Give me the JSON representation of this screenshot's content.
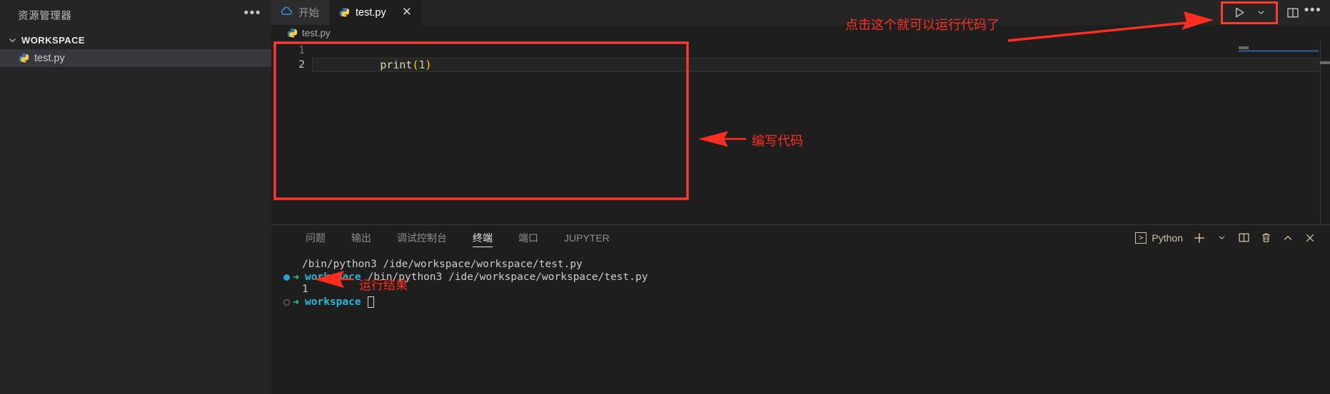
{
  "sidebar": {
    "title": "资源管理器",
    "more_icon": "ellipsis-icon",
    "workspace_label": "WORKSPACE",
    "files": [
      {
        "name": "test.py",
        "icon": "python-file-icon"
      }
    ]
  },
  "tabs": [
    {
      "label": "开始",
      "icon": "cloud-icon",
      "active": false,
      "closable": false
    },
    {
      "label": "test.py",
      "icon": "python-file-icon",
      "active": true,
      "closable": true
    }
  ],
  "tab_actions": {
    "run_icon": "play-triangle-icon",
    "run_dropdown_icon": "chevron-down-icon",
    "split_editor_icon": "split-editor-icon",
    "more_icon": "ellipsis-icon"
  },
  "breadcrumb": {
    "icon": "python-file-icon",
    "label": "test.py"
  },
  "editor": {
    "lines": [
      {
        "number": "1",
        "tokens": [
          {
            "text": "print",
            "type": "fn"
          },
          {
            "text": "(",
            "type": "par"
          },
          {
            "text": "1",
            "type": "num"
          },
          {
            "text": ")",
            "type": "par"
          }
        ],
        "current": false
      },
      {
        "number": "2",
        "tokens": [],
        "current": true
      }
    ]
  },
  "panel": {
    "tabs": [
      {
        "label": "问题",
        "active": false
      },
      {
        "label": "输出",
        "active": false
      },
      {
        "label": "调试控制台",
        "active": false
      },
      {
        "label": "终端",
        "active": true
      },
      {
        "label": "端口",
        "active": false
      },
      {
        "label": "JUPYTER",
        "active": false
      }
    ],
    "actions": {
      "terminal_kind": "Python",
      "terminal_kind_icon": "terminal-chevron-icon",
      "new_terminal_icon": "plus-icon",
      "new_terminal_dropdown_icon": "chevron-down-icon",
      "split_terminal_icon": "split-terminal-icon",
      "kill_terminal_icon": "trash-icon",
      "maximize_panel_icon": "chevron-up-icon",
      "close_panel_icon": "close-icon"
    },
    "terminal_lines": [
      {
        "marker": "none",
        "prompt": false,
        "text": "/bin/python3 /ide/workspace/workspace/test.py"
      },
      {
        "marker": "filled",
        "prompt": true,
        "user": "workspace",
        "text": "/bin/python3 /ide/workspace/workspace/test.py"
      },
      {
        "marker": "none",
        "prompt": false,
        "text": "1"
      },
      {
        "marker": "hollow",
        "prompt": true,
        "user": "workspace",
        "text": "",
        "cursor": true
      }
    ]
  },
  "annotations": [
    {
      "id": "run-hint",
      "text": "点击这个就可以运行代码了"
    },
    {
      "id": "write-code",
      "text": "编写代码"
    },
    {
      "id": "run-result",
      "text": "运行结果"
    }
  ],
  "colors": {
    "annotation_red": "#ff2d20",
    "highlight_box": "#ff3b30",
    "accent_blue": "#2f9bd8",
    "terminal_green": "#23d18b",
    "terminal_cyan": "#29b8db"
  }
}
